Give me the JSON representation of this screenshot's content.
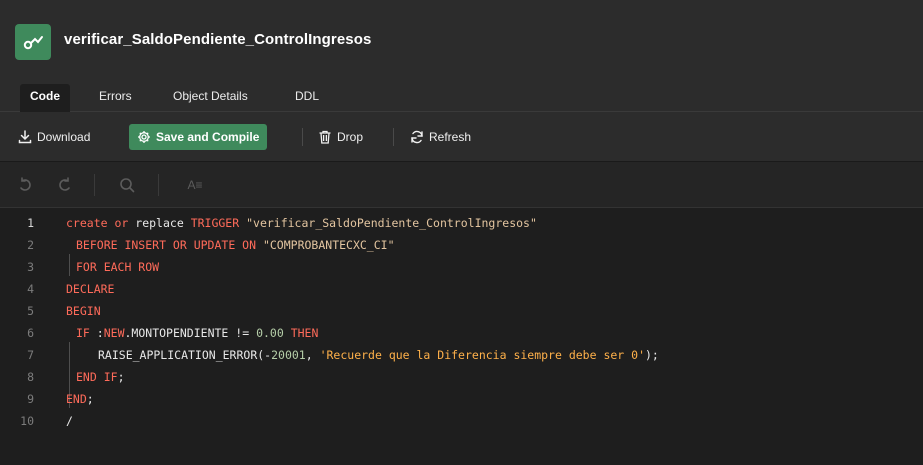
{
  "object": {
    "title": "verificar_SaldoPendiente_ControlIngresos",
    "icon": "trigger-icon",
    "icon_color": "#3f8a5c"
  },
  "tabs": [
    {
      "label": "Code",
      "active": true
    },
    {
      "label": "Errors",
      "active": false
    },
    {
      "label": "Object Details",
      "active": false
    },
    {
      "label": "DDL",
      "active": false
    }
  ],
  "toolbar": {
    "download_label": "Download",
    "save_compile_label": "Save and Compile",
    "drop_label": "Drop",
    "refresh_label": "Refresh"
  },
  "editor_toolbar": {
    "undo_icon": "undo-icon",
    "redo_icon": "redo-icon",
    "search_icon": "search-icon",
    "format_label": "A≡"
  },
  "colors": {
    "keyword": "#ff6b5a",
    "string": "#e3c5a0",
    "single_quoted_string": "#ffb14a",
    "number": "#b5cea8",
    "accent": "#3f8a5c"
  },
  "code": {
    "lines": [
      {
        "num": "1",
        "tokens": [
          [
            "kw",
            "create"
          ],
          [
            "txt",
            " "
          ],
          [
            "kw",
            "or"
          ],
          [
            "txt",
            " "
          ],
          [
            "txt",
            "replace"
          ],
          [
            "txt",
            " "
          ],
          [
            "kw",
            "TRIGGER"
          ],
          [
            "txt",
            " "
          ],
          [
            "str",
            "\"verificar_SaldoPendiente_ControlIngresos\""
          ]
        ]
      },
      {
        "num": "2",
        "tokens": [
          [
            "kw",
            "BEFORE INSERT OR UPDATE ON"
          ],
          [
            "txt",
            " "
          ],
          [
            "str",
            "\"COMPROBANTECXC_CI\""
          ]
        ]
      },
      {
        "num": "3",
        "tokens": [
          [
            "kw",
            "FOR EACH ROW"
          ]
        ]
      },
      {
        "num": "4",
        "tokens": [
          [
            "kw",
            "DECLARE"
          ]
        ]
      },
      {
        "num": "5",
        "tokens": [
          [
            "kw",
            "BEGIN"
          ]
        ]
      },
      {
        "num": "6",
        "tokens": [
          [
            "kw",
            "IF"
          ],
          [
            "txt",
            " :"
          ],
          [
            "kw",
            "NEW"
          ],
          [
            "txt",
            ".MONTOPENDIENTE != "
          ],
          [
            "num",
            "0.00"
          ],
          [
            "txt",
            " "
          ],
          [
            "kw",
            "THEN"
          ]
        ]
      },
      {
        "num": "7",
        "tokens": [
          [
            "txt",
            "RAISE_APPLICATION_ERROR(-"
          ],
          [
            "num",
            "20001"
          ],
          [
            "txt",
            ", "
          ],
          [
            "sq",
            "'Recuerde que la Diferencia siempre debe ser 0'"
          ],
          [
            "txt",
            ");"
          ]
        ]
      },
      {
        "num": "8",
        "tokens": [
          [
            "kw",
            "END"
          ],
          [
            "txt",
            " "
          ],
          [
            "kw",
            "IF"
          ],
          [
            "txt",
            ";"
          ]
        ]
      },
      {
        "num": "9",
        "tokens": [
          [
            "kw",
            "END"
          ],
          [
            "txt",
            ";"
          ]
        ]
      },
      {
        "num": "10",
        "tokens": [
          [
            "txt",
            "/"
          ]
        ]
      }
    ]
  }
}
